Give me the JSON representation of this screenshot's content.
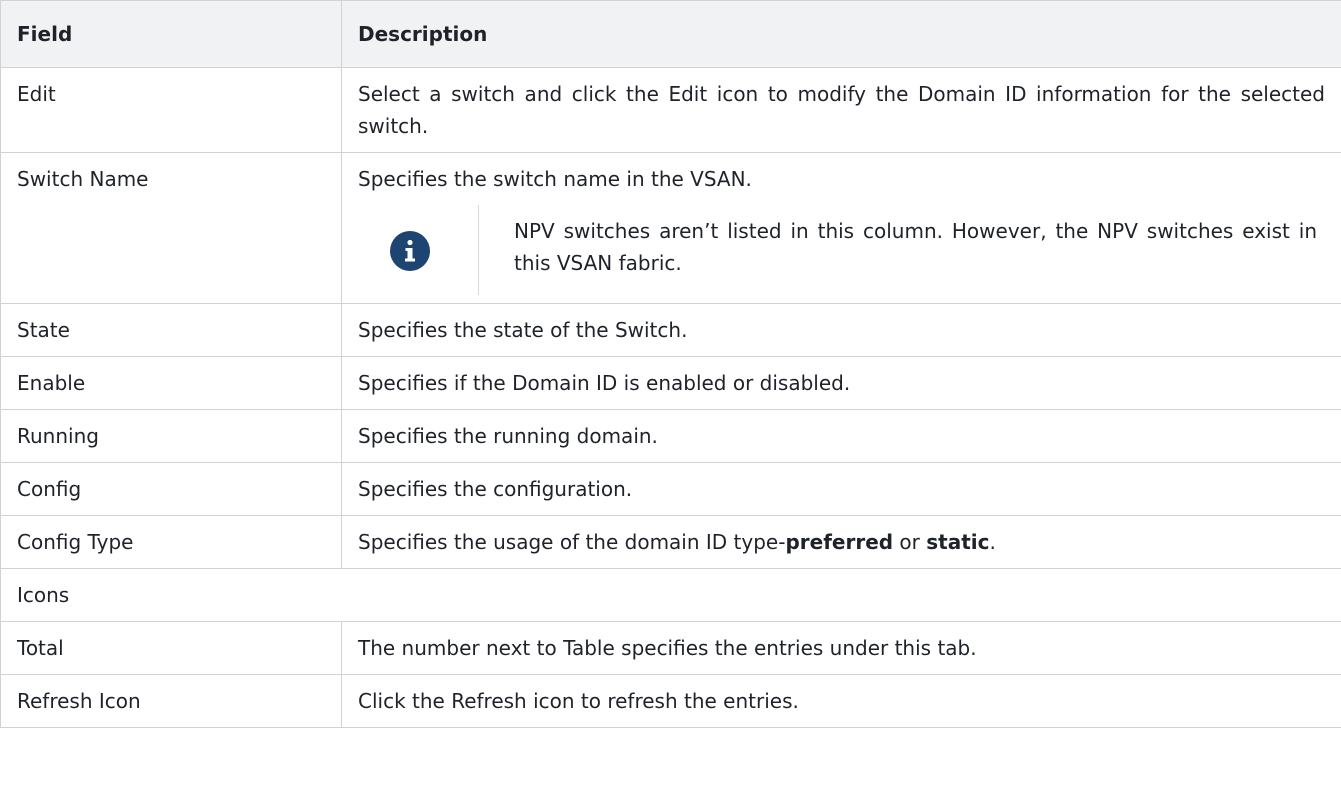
{
  "table": {
    "headers": {
      "field": "Field",
      "description": "Description"
    },
    "rows": [
      {
        "field": "Edit",
        "description": "Select a switch and click the Edit icon to modify the Domain ID information for the selected switch."
      },
      {
        "field": "Switch Name",
        "description": "Specifies the switch name in the VSAN.",
        "note": "NPV switches aren’t listed in this column. However, the NPV switches exist in this VSAN fabric."
      },
      {
        "field": "State",
        "description": "Specifies the state of the Switch."
      },
      {
        "field": "Enable",
        "description": "Specifies if the Domain ID is enabled or disabled."
      },
      {
        "field": "Running",
        "description": "Specifies the running domain."
      },
      {
        "field": "Config",
        "description": "Specifies the configuration."
      },
      {
        "field": "Config Type",
        "description_prefix": "Specifies the usage of the domain ID type-",
        "description_bold1": "preferred",
        "description_mid": " or ",
        "description_bold2": "static",
        "description_suffix": "."
      },
      {
        "section": "Icons"
      },
      {
        "field": "Total",
        "description": "The number next to Table specifies the entries under this tab."
      },
      {
        "field": "Refresh Icon",
        "description": "Click the Refresh icon to refresh the entries."
      }
    ]
  },
  "icons": {
    "note": "info-icon"
  },
  "colors": {
    "note_icon": "#1e4471",
    "header_bg": "#f0f2f4",
    "border": "#cfd3d6"
  }
}
